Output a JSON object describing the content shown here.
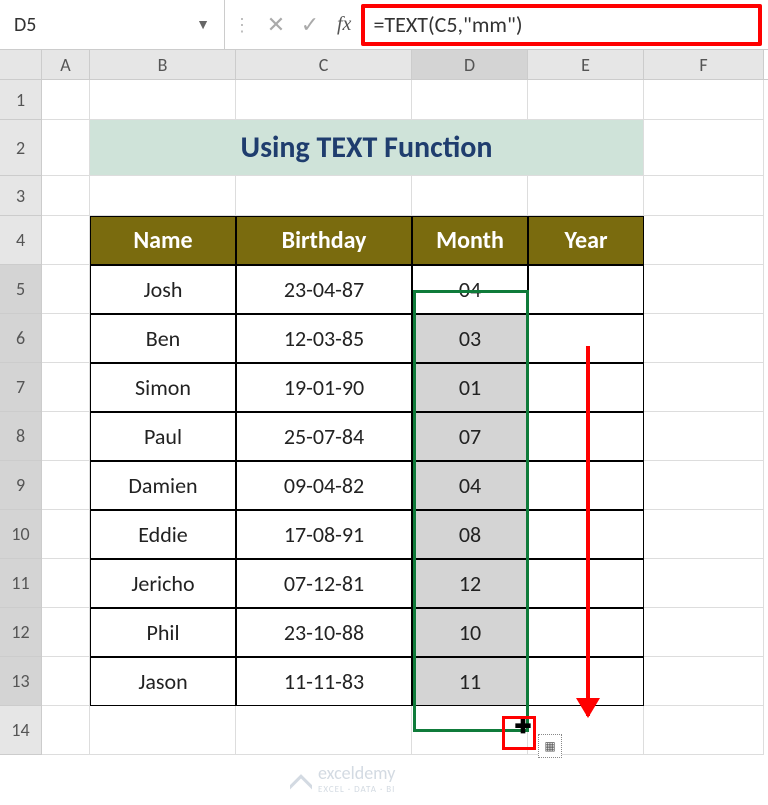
{
  "name_box": "D5",
  "formula": "=TEXT(C5,\"mm\")",
  "fx_label": "fx",
  "columns": [
    "A",
    "B",
    "C",
    "D",
    "E",
    "F"
  ],
  "row_nums": [
    "1",
    "2",
    "3",
    "4",
    "5",
    "6",
    "7",
    "8",
    "9",
    "10",
    "11",
    "12",
    "13",
    "14"
  ],
  "title": "Using TEXT Function",
  "headers": {
    "name": "Name",
    "birthday": "Birthday",
    "month": "Month",
    "year": "Year"
  },
  "rows": [
    {
      "name": "Josh",
      "birthday": "23-04-87",
      "month": "04"
    },
    {
      "name": "Ben",
      "birthday": "12-03-85",
      "month": "03"
    },
    {
      "name": "Simon",
      "birthday": "19-01-90",
      "month": "01"
    },
    {
      "name": "Paul",
      "birthday": "25-07-84",
      "month": "07"
    },
    {
      "name": "Damien",
      "birthday": "09-04-82",
      "month": "04"
    },
    {
      "name": "Eddie",
      "birthday": "17-08-91",
      "month": "08"
    },
    {
      "name": "Jericho",
      "birthday": "07-12-81",
      "month": "12"
    },
    {
      "name": "Phil",
      "birthday": "23-10-88",
      "month": "10"
    },
    {
      "name": "Jason",
      "birthday": "11-11-83",
      "month": "11"
    }
  ],
  "watermark": {
    "brand": "exceldemy",
    "sub": "EXCEL · DATA · BI"
  },
  "autofill_glyph": "▦"
}
